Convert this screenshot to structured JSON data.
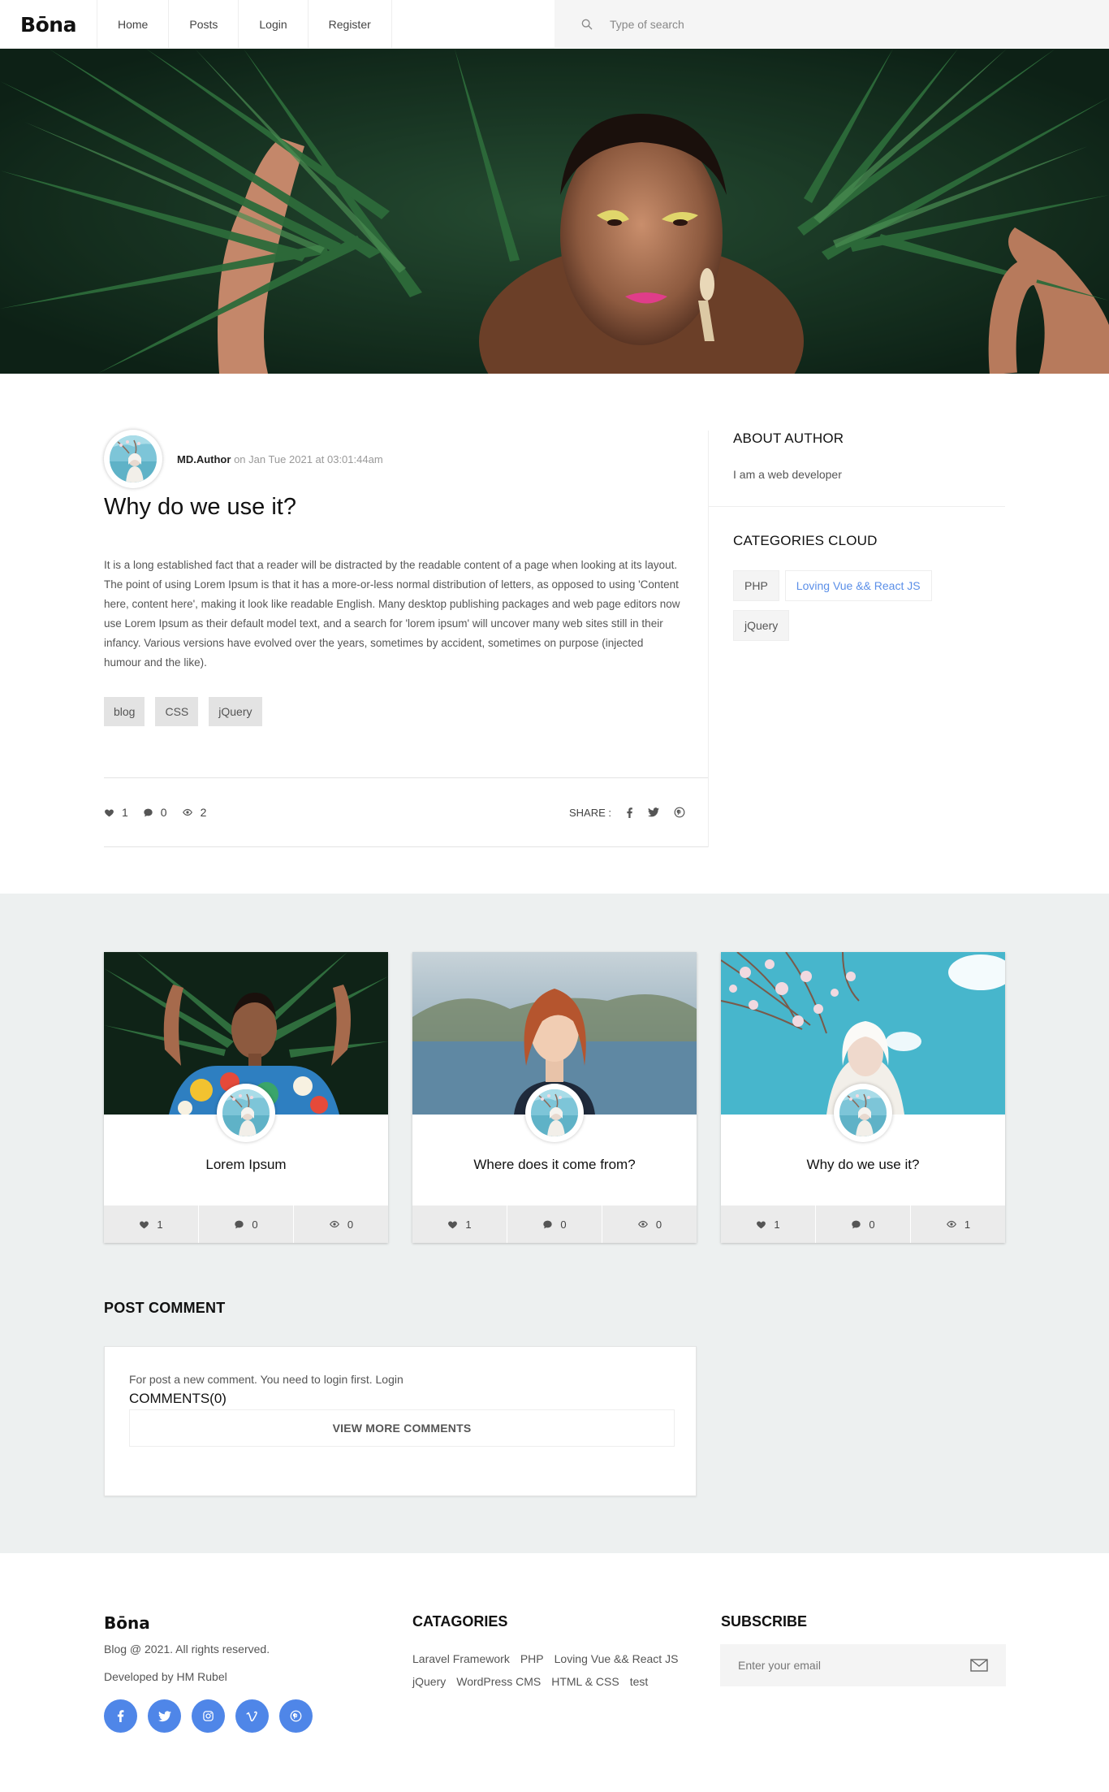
{
  "brand": {
    "logo": "Bōna"
  },
  "nav": {
    "items": [
      "Home",
      "Posts",
      "Login",
      "Register"
    ]
  },
  "search": {
    "placeholder": "Type of search"
  },
  "post": {
    "author": "MD.Author",
    "date_text": "on Jan Tue 2021 at 03:01:44am",
    "title": "Why do we use it?",
    "body": "It is a long established fact that a reader will be distracted by the readable content of a page when looking at its layout. The point of using Lorem Ipsum is that it has a more-or-less normal distribution of letters, as opposed to using 'Content here, content here', making it look like readable English. Many desktop publishing packages and web page editors now use Lorem Ipsum as their default model text, and a search for 'lorem ipsum' will uncover many web sites still in their infancy. Various versions have evolved over the years, sometimes by accident, sometimes on purpose (injected humour and the like).",
    "tags": [
      "blog",
      "CSS",
      "jQuery"
    ],
    "likes": "1",
    "comments": "0",
    "views": "2",
    "share_label": "SHARE :"
  },
  "sidebar": {
    "about_title": "ABOUT AUTHOR",
    "about_text": "I am a web developer",
    "categories_title": "CATEGORIES CLOUD",
    "categories": [
      "PHP",
      "Loving Vue && React JS",
      "jQuery"
    ]
  },
  "related": [
    {
      "title": "Lorem Ipsum",
      "likes": "1",
      "comments": "0",
      "views": "0"
    },
    {
      "title": "Where does it come from?",
      "likes": "1",
      "comments": "0",
      "views": "0"
    },
    {
      "title": "Why do we use it?",
      "likes": "1",
      "comments": "0",
      "views": "1"
    }
  ],
  "comments": {
    "section_title": "POST COMMENT",
    "note": "For post a new comment. You need to login first.",
    "login_link": "Login",
    "count_label": "COMMENTS(0)",
    "view_more": "VIEW MORE COMMENTS"
  },
  "footer": {
    "logo": "Bōna",
    "copyright": "Blog @ 2021. All rights reserved.",
    "developed": "Developed by HM Rubel",
    "categories_title": "CATAGORIES",
    "categories": [
      "Laravel Framework",
      "PHP",
      "Loving Vue && React JS",
      "jQuery",
      "WordPress CMS",
      "HTML & CSS",
      "test"
    ],
    "subscribe_title": "SUBSCRIBE",
    "email_placeholder": "Enter your email"
  },
  "colors": {
    "accent": "#4f86e8",
    "link": "#5b8fe8",
    "section_bg": "#edf0f0"
  },
  "icons": [
    "search-icon",
    "heart-icon",
    "comment-icon",
    "eye-icon",
    "facebook-icon",
    "twitter-icon",
    "pinterest-icon",
    "instagram-icon",
    "vimeo-icon",
    "envelope-icon"
  ]
}
